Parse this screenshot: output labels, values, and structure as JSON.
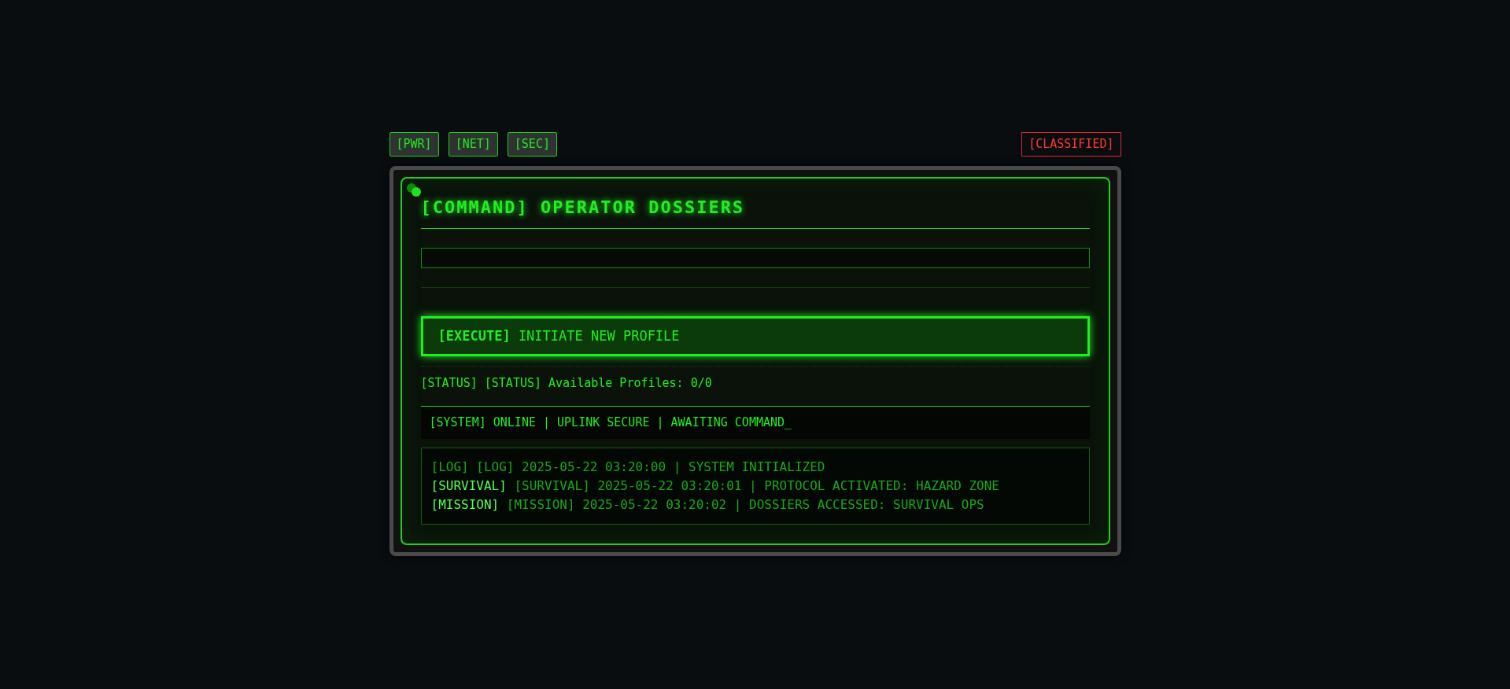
{
  "top_buttons": [
    {
      "label": "[PWR]"
    },
    {
      "label": "[NET]"
    },
    {
      "label": "[SEC]"
    }
  ],
  "badge": "[CLASSIFIED]",
  "title": "[COMMAND] OPERATOR DOSSIERS",
  "execute": {
    "tag": "[EXECUTE]",
    "label": "INITIATE NEW PROFILE"
  },
  "status": "[STATUS] [STATUS] Available Profiles: 0/0",
  "system_bar": "[SYSTEM] ONLINE | UPLINK SECURE | AWAITING COMMAND_",
  "log": [
    {
      "text": "[LOG] [LOG] 2025-05-22 03:20:00 | SYSTEM INITIALIZED"
    },
    {
      "tag": "[SURVIVAL]",
      "text": "[SURVIVAL] 2025-05-22 03:20:01 | PROTOCOL ACTIVATED: HAZARD ZONE"
    },
    {
      "tag": "[MISSION]",
      "text": "[MISSION] 2025-05-22 03:20:02 | DOSSIERS ACCESSED: SURVIVAL OPS"
    }
  ]
}
